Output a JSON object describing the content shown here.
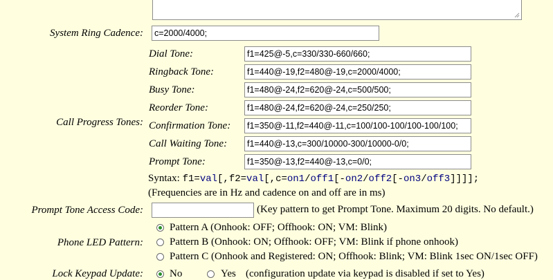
{
  "system_ring_cadence": {
    "label": "System Ring Cadence:",
    "value": "c=2000/4000;"
  },
  "call_progress": {
    "label": "Call Progress Tones:",
    "tones": [
      {
        "label": "Dial Tone:",
        "value": "f1=425@-5,c=330/330-660/660;"
      },
      {
        "label": "Ringback Tone:",
        "value": "f1=440@-19,f2=480@-19,c=2000/4000;"
      },
      {
        "label": "Busy Tone:",
        "value": "f1=480@-24,f2=620@-24,c=500/500;"
      },
      {
        "label": "Reorder Tone:",
        "value": "f1=480@-24,f2=620@-24,c=250/250;"
      },
      {
        "label": "Confirmation Tone:",
        "value": "f1=350@-11,f2=440@-11,c=100/100-100/100-100/100;"
      },
      {
        "label": "Call Waiting Tone:",
        "value": "f1=440@-13,c=300/10000-300/10000-0/0;"
      },
      {
        "label": "Prompt Tone:",
        "value": "f1=350@-13,f2=440@-13,c=0/0;"
      }
    ],
    "syntax_prefix": "Syntax:",
    "syntax_parts": [
      {
        "text": "f1=",
        "kw": false
      },
      {
        "text": "val",
        "kw": true
      },
      {
        "text": "[,f2=",
        "kw": false
      },
      {
        "text": "val",
        "kw": true
      },
      {
        "text": "[,c=",
        "kw": false
      },
      {
        "text": "on1",
        "kw": true
      },
      {
        "text": "/",
        "kw": false
      },
      {
        "text": "off1",
        "kw": true
      },
      {
        "text": "[-",
        "kw": false
      },
      {
        "text": "on2",
        "kw": true
      },
      {
        "text": "/",
        "kw": false
      },
      {
        "text": "off2",
        "kw": true
      },
      {
        "text": "[-",
        "kw": false
      },
      {
        "text": "on3",
        "kw": true
      },
      {
        "text": "/",
        "kw": false
      },
      {
        "text": "off3",
        "kw": true
      },
      {
        "text": "]]]];",
        "kw": false
      }
    ],
    "note": "(Frequencies are in Hz and cadence on and off are in ms)"
  },
  "prompt_tone_access_code": {
    "label": "Prompt Tone Access Code:",
    "value": "",
    "hint": "(Key pattern to get Prompt Tone. Maximum 20 digits. No default.)"
  },
  "phone_led_pattern": {
    "label": "Phone LED Pattern:",
    "options": [
      {
        "label": "Pattern A (Onhook: OFF; Offhook: ON; VM: Blink)",
        "selected": true
      },
      {
        "label": "Pattern B (Onhook: ON; Offhook: OFF; VM: Blink if phone onhook)",
        "selected": false
      },
      {
        "label": "Pattern C (Onhook and Registered: ON; Offhook: Blink; VM: Blink 1sec ON/1sec OFF)",
        "selected": false
      }
    ]
  },
  "lock_keypad_update": {
    "label": "Lock Keypad Update:",
    "no_label": "No",
    "yes_label": "Yes",
    "selected": "No",
    "hint": "(configuration update via keypad is disabled if set to Yes)"
  },
  "colors": {
    "background": "#ffffe0",
    "syntax_keyword": "#000080",
    "radio_selected": "#2a8f2a"
  }
}
